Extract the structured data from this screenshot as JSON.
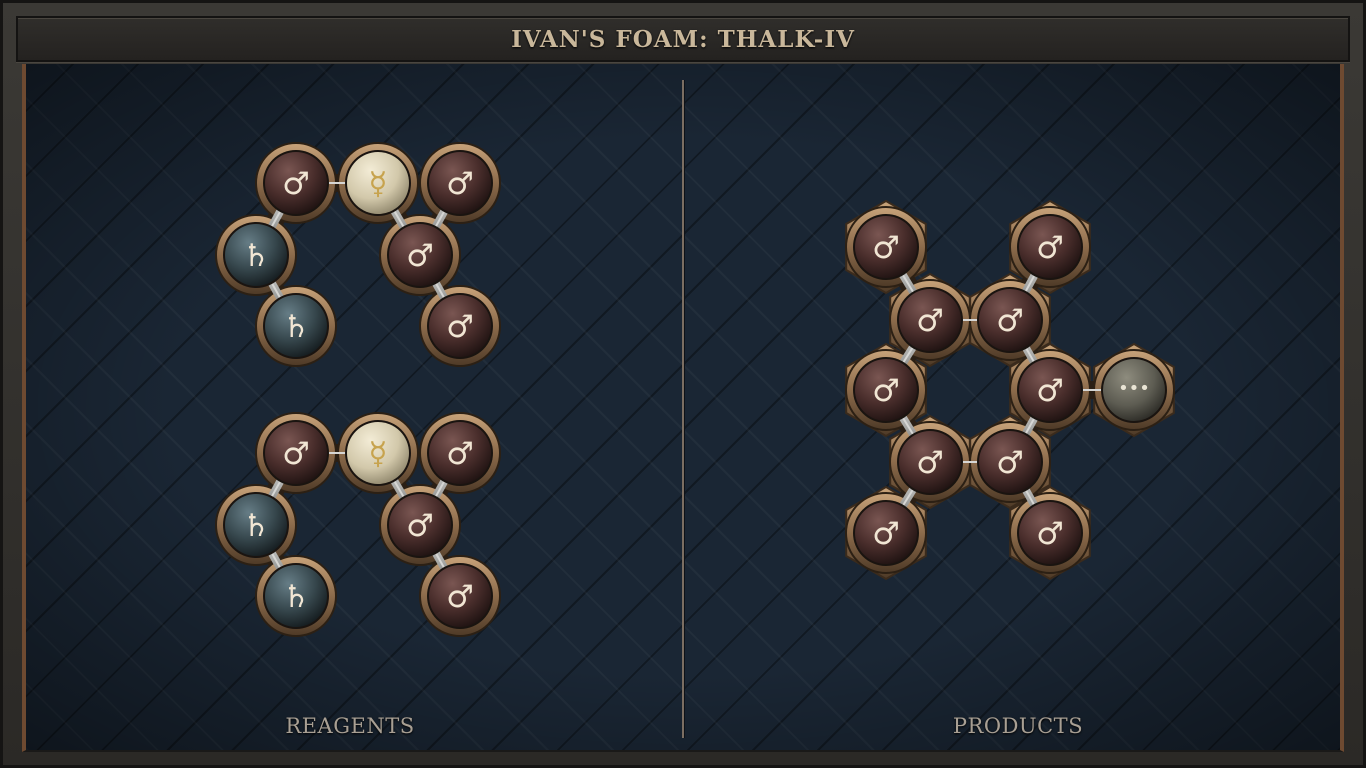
{
  "title": "IVAN'S FOAM: THALK-IV",
  "panels": {
    "reagents_label": "REAGENTS",
    "products_label": "PRODUCTS"
  },
  "glyphs": {
    "iron": "♂",
    "mercury": "☿",
    "lead": "♄",
    "unknown": "•••"
  },
  "colors": {
    "iron_fill": "#4a2e2c",
    "mercury_fill": "#d8d0b4",
    "lead_fill": "#3a4d55",
    "unknown_fill": "#5d5c52",
    "bronze": "#9a7a58",
    "glyph_light": "#f1e6d4",
    "glyph_mercury": "#c7a34e"
  },
  "molecules": {
    "reagent_1": {
      "atoms": [
        "iron",
        "mercury",
        "iron",
        "lead",
        "iron",
        "lead",
        "iron"
      ],
      "bonds": [
        [
          0,
          1
        ],
        [
          1,
          4
        ],
        [
          2,
          4
        ],
        [
          0,
          3
        ],
        [
          3,
          5
        ],
        [
          4,
          6
        ]
      ]
    },
    "reagent_2": {
      "atoms": [
        "iron",
        "mercury",
        "iron",
        "lead",
        "iron",
        "lead",
        "iron"
      ],
      "bonds": [
        [
          0,
          1
        ],
        [
          1,
          4
        ],
        [
          2,
          4
        ],
        [
          0,
          3
        ],
        [
          3,
          5
        ],
        [
          4,
          6
        ]
      ]
    },
    "product": {
      "atoms": [
        "iron",
        "iron",
        "iron",
        "iron",
        "iron",
        "iron",
        "iron",
        "iron",
        "iron",
        "iron",
        "unknown"
      ],
      "bonds": [
        [
          0,
          2
        ],
        [
          1,
          3
        ],
        [
          2,
          3
        ],
        [
          2,
          4
        ],
        [
          3,
          5
        ],
        [
          4,
          6
        ],
        [
          5,
          7
        ],
        [
          6,
          7
        ],
        [
          6,
          8
        ],
        [
          7,
          9
        ],
        [
          5,
          10
        ]
      ]
    }
  }
}
